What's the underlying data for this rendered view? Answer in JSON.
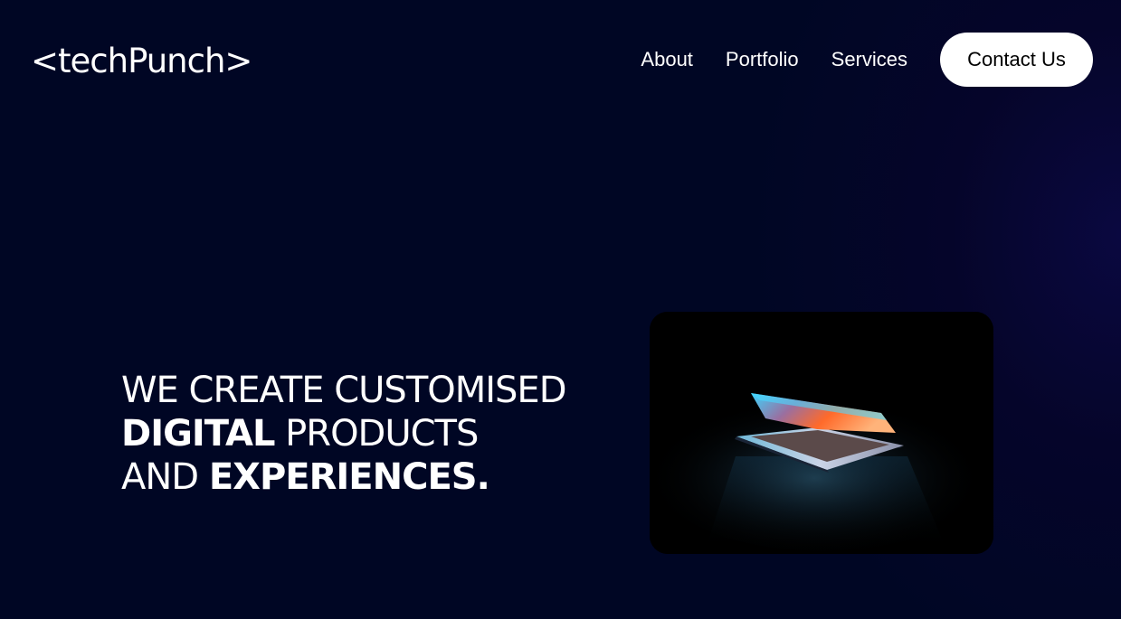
{
  "brand": {
    "logo_text": "<techPunch>"
  },
  "nav": {
    "items": [
      {
        "label": "About"
      },
      {
        "label": "Portfolio"
      },
      {
        "label": "Services"
      }
    ],
    "contact_label": "Contact Us"
  },
  "hero": {
    "line1": "WE CREATE CUSTOMISED",
    "line2_bold": "DIGITAL",
    "line2_rest": " PRODUCTS",
    "line3_pre": "AND ",
    "line3_bold": "EXPERIENCES."
  },
  "colors": {
    "background": "#000624",
    "text": "#ffffff",
    "button_bg": "#ffffff",
    "button_text": "#000000"
  }
}
